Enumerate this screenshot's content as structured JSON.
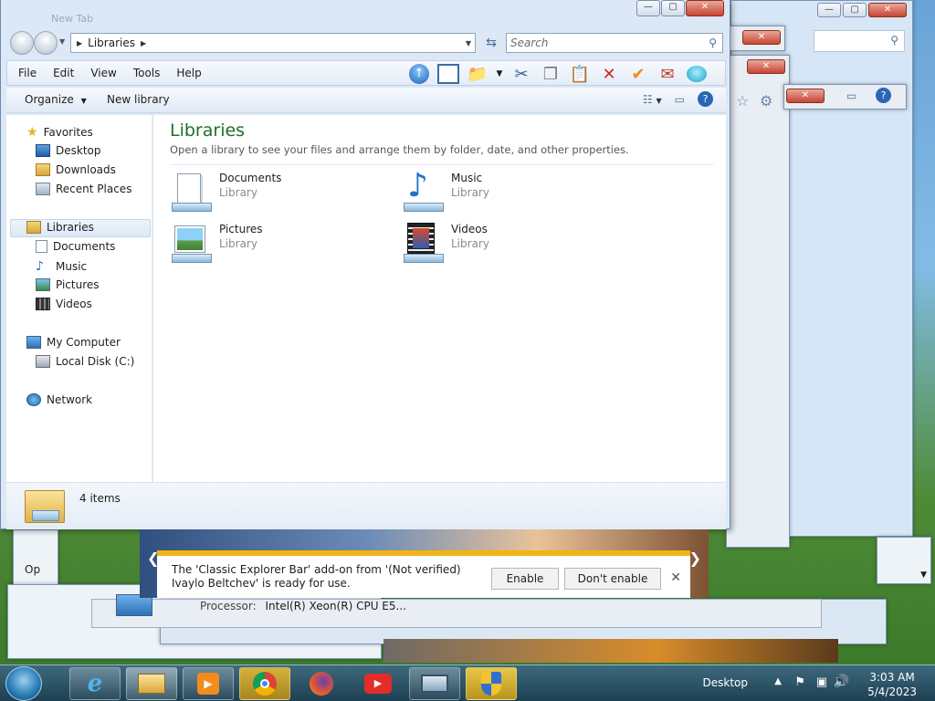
{
  "window": {
    "ghost_tab": "New Tab",
    "address": {
      "crumb": "Libraries"
    },
    "search": {
      "placeholder": "Search"
    }
  },
  "menubar": {
    "items": [
      "File",
      "Edit",
      "View",
      "Tools",
      "Help"
    ]
  },
  "commandbar": {
    "organize": "Organize",
    "new_library": "New library"
  },
  "navpane": {
    "favorites": "Favorites",
    "desktop": "Desktop",
    "downloads": "Downloads",
    "recent_places": "Recent Places",
    "libraries": "Libraries",
    "documents": "Documents",
    "music": "Music",
    "pictures": "Pictures",
    "videos": "Videos",
    "my_computer": "My Computer",
    "local_disk": "Local Disk (C:)",
    "network": "Network"
  },
  "content": {
    "title": "Libraries",
    "subtitle": "Open a library to see your files and arrange them by folder, date, and other properties.",
    "items": [
      {
        "name": "Documents",
        "type": "Library"
      },
      {
        "name": "Music",
        "type": "Library"
      },
      {
        "name": "Pictures",
        "type": "Library"
      },
      {
        "name": "Videos",
        "type": "Library"
      }
    ]
  },
  "details": {
    "count": "4 items"
  },
  "notification": {
    "message": "The 'Classic Explorer Bar' add-on from '(Not verified) Ivaylo Beltchev' is ready for use.",
    "enable": "Enable",
    "dont_enable": "Don't enable"
  },
  "sysinfo": {
    "processor_label": "Processor:",
    "processor_value": "Intel(R) Xeon(R) CPU E5..."
  },
  "bg_fragment": {
    "text": "Op"
  },
  "taskbar": {
    "desktop_label": "Desktop",
    "time": "3:03 AM",
    "date": "5/4/2023"
  },
  "colors": {
    "library_title": "#1e6f2b",
    "notification_accent": "#f2b416",
    "taskbar": "#1e3f52"
  }
}
